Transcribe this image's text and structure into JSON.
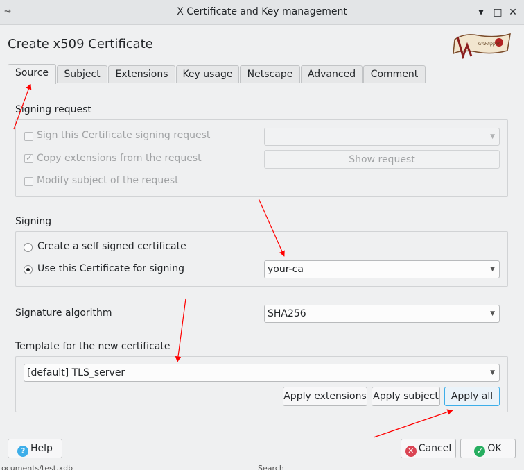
{
  "window": {
    "title": "X Certificate and Key management",
    "controls": [
      "minimize-icon",
      "maximize-icon",
      "close-icon"
    ]
  },
  "dialog": {
    "title": "Create x509 Certificate",
    "logo_text": "Gr.Flipper"
  },
  "tabs": [
    "Source",
    "Subject",
    "Extensions",
    "Key usage",
    "Netscape",
    "Advanced",
    "Comment"
  ],
  "signing_request": {
    "heading": "Signing request",
    "sign_csr": {
      "label": "Sign this Certificate signing request",
      "checked": false,
      "enabled": false
    },
    "copy_ext": {
      "label": "Copy extensions from the request",
      "checked": true,
      "enabled": false
    },
    "modify_subject": {
      "label": "Modify subject of the request",
      "checked": false,
      "enabled": false
    },
    "csr_select": "",
    "show_request": "Show request"
  },
  "signing": {
    "heading": "Signing",
    "self_signed": {
      "label": "Create a self signed certificate",
      "selected": false
    },
    "use_cert": {
      "label": "Use this Certificate for signing",
      "selected": true
    },
    "ca_select": "your-ca"
  },
  "signature": {
    "label": "Signature algorithm",
    "value": "SHA256"
  },
  "template": {
    "heading": "Template for the new certificate",
    "value": "[default] TLS_server",
    "apply_extensions": "Apply extensions",
    "apply_subject": "Apply subject",
    "apply_all": "Apply all"
  },
  "footer": {
    "help": "Help",
    "cancel": "Cancel",
    "ok": "OK"
  },
  "status": {
    "left": "ocuments/test.xdb",
    "right": "Search"
  },
  "colors": {
    "arrow": "#ff0000",
    "help_icon": "#3daee9",
    "cancel_icon": "#da4453",
    "ok_icon": "#27ae60",
    "accent": "#3daee9"
  }
}
